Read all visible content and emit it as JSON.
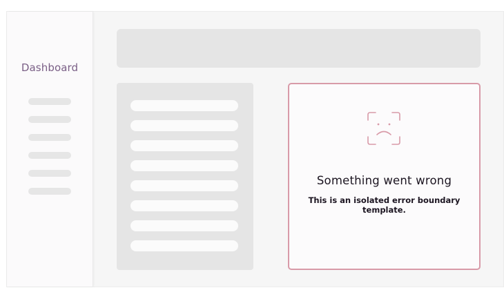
{
  "sidebar": {
    "title": "Dashboard",
    "skeleton_item_count": 6
  },
  "main": {
    "list_skeleton_count": 8
  },
  "error": {
    "icon": "sad-face-icon",
    "title": "Something went wrong",
    "message": "This is an isolated error boundary template."
  },
  "colors": {
    "accent": "#7a5f86",
    "error_border": "#d89aa8",
    "skeleton": "#e5e5e5",
    "text": "#1c1521"
  }
}
